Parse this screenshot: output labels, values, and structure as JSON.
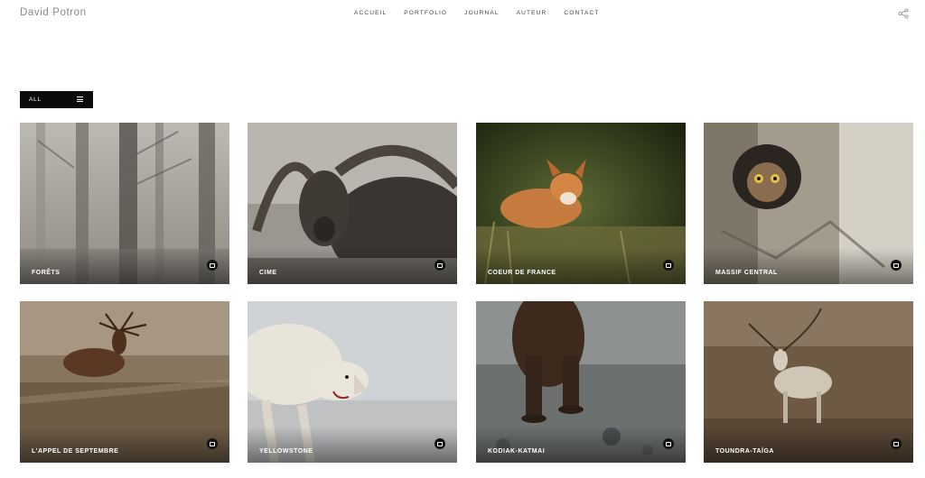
{
  "site": {
    "logo": "David Potron"
  },
  "nav": [
    "ACCUEIL",
    "PORTFOLIO",
    "JOURNAL",
    "AUTEUR",
    "CONTACT"
  ],
  "filter": {
    "label": "ALL"
  },
  "galleries": [
    {
      "title": "FORÊTS",
      "icon": "image-icon"
    },
    {
      "title": "CIME",
      "icon": "image-icon"
    },
    {
      "title": "COEUR DE FRANCE",
      "icon": "image-icon"
    },
    {
      "title": "MASSIF CENTRAL",
      "icon": "image-icon"
    },
    {
      "title": "L'APPEL DE SEPTEMBRE",
      "icon": "image-icon"
    },
    {
      "title": "YELLOWSTONE",
      "icon": "image-icon"
    },
    {
      "title": "KODIAK-KATMAI",
      "icon": "image-icon"
    },
    {
      "title": "TOUNDRA-TAÏGA",
      "icon": "image-icon"
    }
  ]
}
